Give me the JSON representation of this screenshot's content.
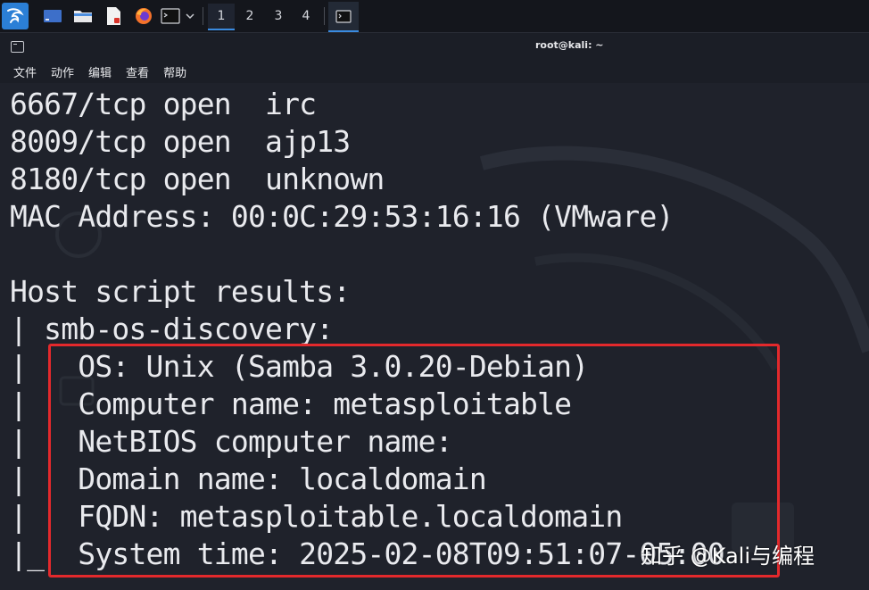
{
  "panel": {
    "workspaces": [
      "1",
      "2",
      "3",
      "4"
    ],
    "active_workspace": "1",
    "icons": [
      "kali-menu-icon",
      "desktop-icon",
      "file-manager-icon",
      "text-editor-icon",
      "firefox-icon",
      "terminal-icon",
      "chevron-down-icon",
      "terminal-task-icon"
    ],
    "accent_color": "#3a8be0"
  },
  "window": {
    "title": "root@kali: ~"
  },
  "menu": {
    "file": "文件",
    "actions": "动作",
    "edit": "编辑",
    "view": "查看",
    "help": "帮助"
  },
  "terminal": {
    "lines": [
      "6667/tcp open  irc",
      "8009/tcp open  ajp13",
      "8180/tcp open  unknown",
      "MAC Address: 00:0C:29:53:16:16 (VMware)",
      "",
      "Host script results:",
      "| smb-os-discovery:",
      "|   OS: Unix (Samba 3.0.20-Debian)",
      "|   Computer name: metasploitable",
      "|   NetBIOS computer name:",
      "|   Domain name: localdomain",
      "|   FQDN: metasploitable.localdomain",
      "|_  System time: 2025-02-08T09:51:07-05:00"
    ],
    "highlight_color": "#e3292c"
  },
  "watermark": {
    "text": "知乎 @Kali与编程"
  }
}
